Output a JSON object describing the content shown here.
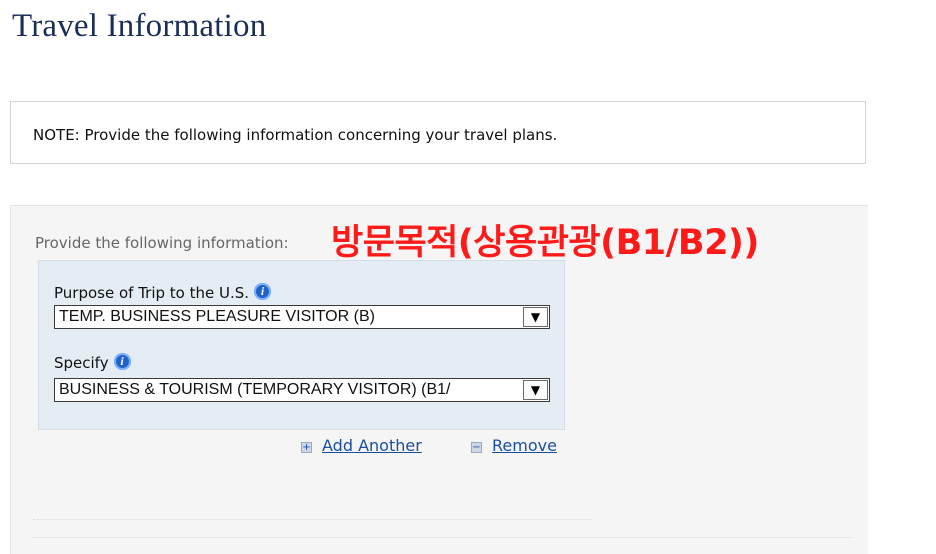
{
  "page": {
    "title": "Travel Information"
  },
  "note": {
    "text": "NOTE: Provide the following information concerning your travel plans."
  },
  "form": {
    "instruction": "Provide the following information:",
    "annotation": "방문목적(상용관광(B1/B2))",
    "fields": [
      {
        "label": "Purpose of Trip to the U.S.",
        "value": "TEMP. BUSINESS PLEASURE VISITOR (B)",
        "icon": "info-icon"
      },
      {
        "label": "Specify",
        "value": "BUSINESS & TOURISM (TEMPORARY VISITOR) (B1/",
        "icon": "info-icon"
      }
    ],
    "actions": {
      "add_label": "Add Another",
      "remove_label": "Remove"
    }
  },
  "colors": {
    "title": "#1b2e5a",
    "annotation": "#ff1a1a",
    "link": "#1a4ea0",
    "field_group_bg": "#e4ecf4",
    "panel_bg": "#f5f5f5",
    "info_icon": "#1f63c7"
  }
}
